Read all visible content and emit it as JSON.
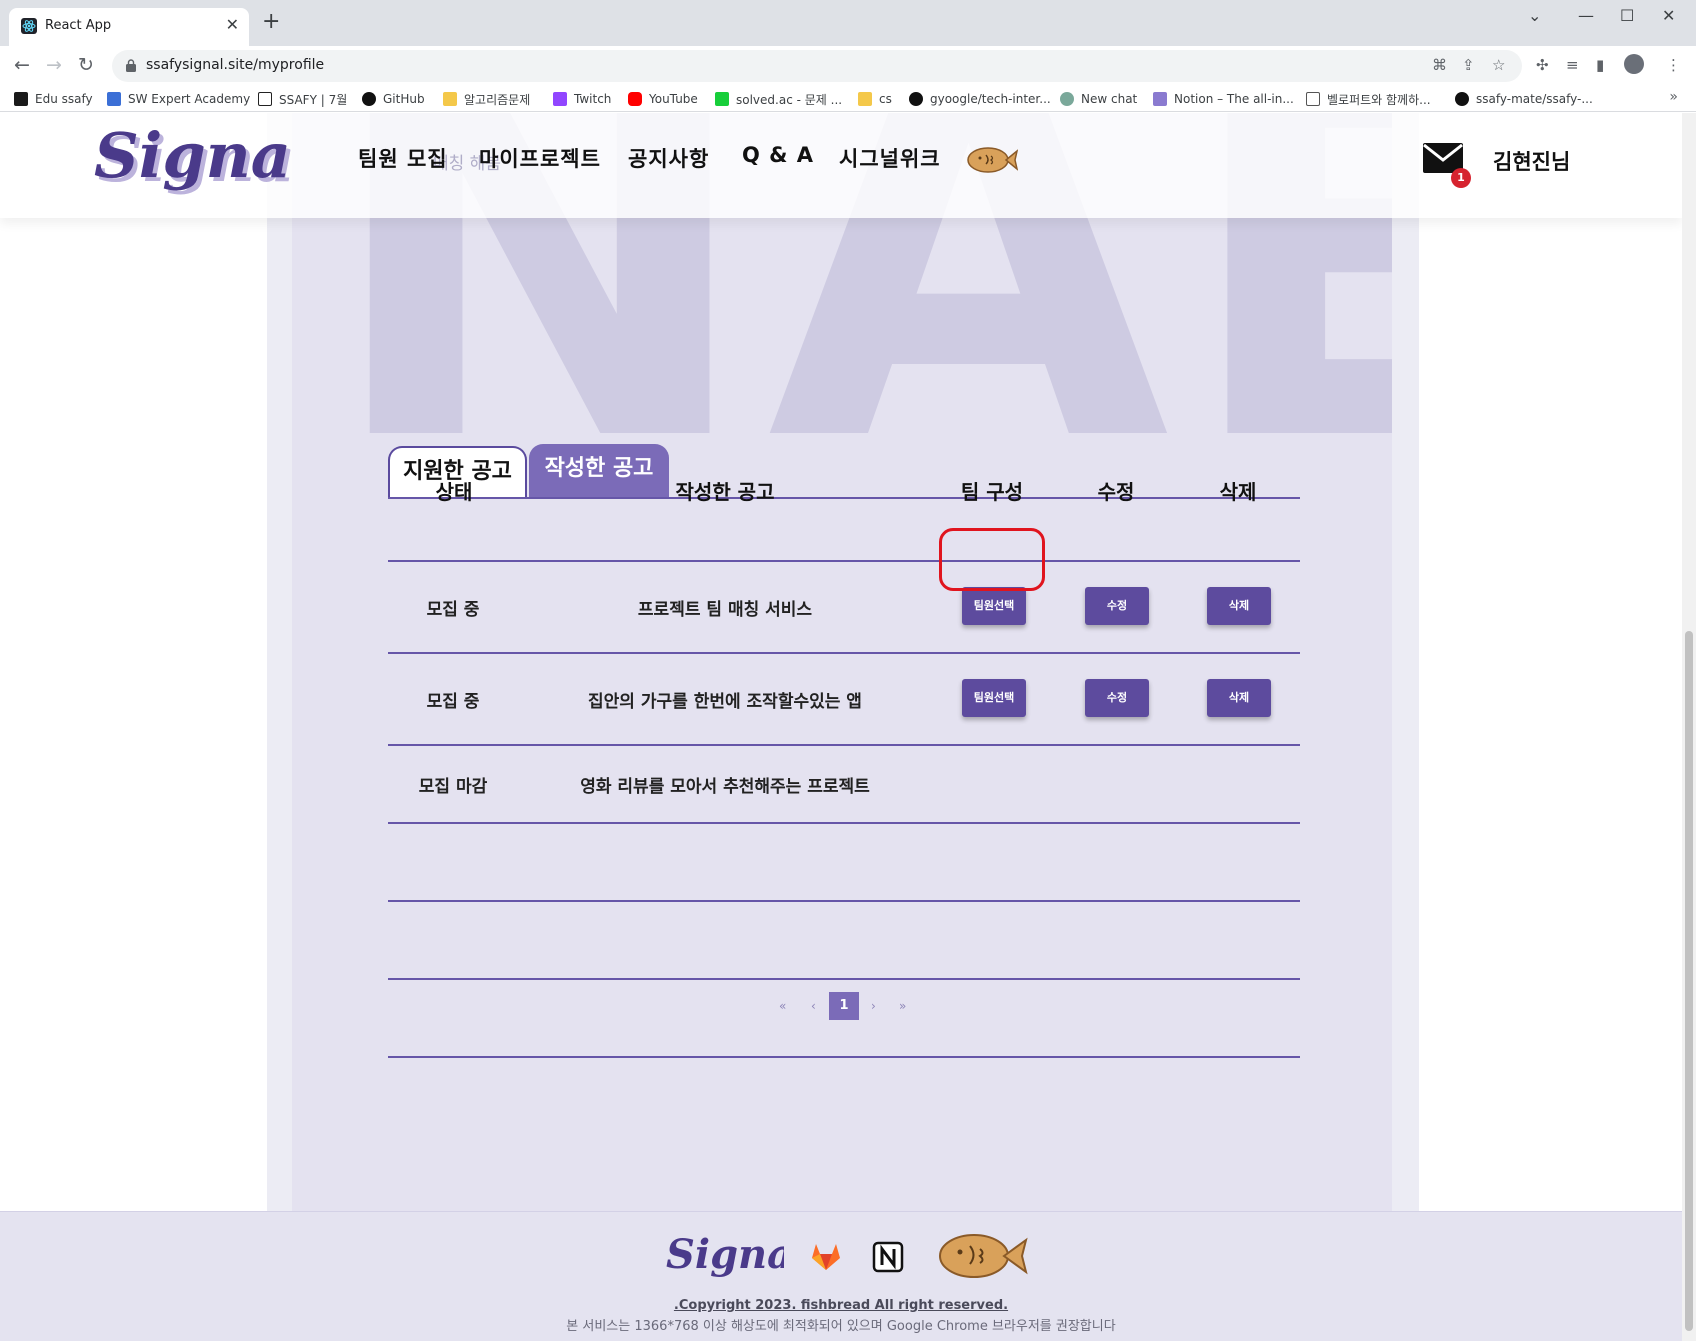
{
  "browser": {
    "tab_title": "React App",
    "url": "ssafysignal.site/myprofile",
    "bookmarks": [
      {
        "label": "Edu ssafy",
        "icon": "edu-ssafy-icon",
        "color": "#1a1a1a"
      },
      {
        "label": "SW Expert Academy",
        "icon": "swea-icon",
        "color": "#3b6fd6"
      },
      {
        "label": "SSAFY | 7월",
        "icon": "notion-icon",
        "color": "#222222"
      },
      {
        "label": "GitHub",
        "icon": "github-icon",
        "color": "#111111"
      },
      {
        "label": "알고리즘문제",
        "icon": "folder-icon",
        "color": "#f4c84a"
      },
      {
        "label": "Twitch",
        "icon": "twitch-icon",
        "color": "#9146ff"
      },
      {
        "label": "YouTube",
        "icon": "youtube-icon",
        "color": "#ff0000"
      },
      {
        "label": "solved.ac - 문제 ...",
        "icon": "solvedac-icon",
        "color": "#17ce3a"
      },
      {
        "label": "cs",
        "icon": "folder-icon",
        "color": "#f4c84a"
      },
      {
        "label": "gyoogle/tech-inter...",
        "icon": "github-icon",
        "color": "#111111"
      },
      {
        "label": "New chat",
        "icon": "chatgpt-icon",
        "color": "#7aa89a"
      },
      {
        "label": "Notion – The all-in...",
        "icon": "notion-bird-icon",
        "color": "#8a7ad0"
      },
      {
        "label": "벨로퍼트와 함께하...",
        "icon": "book-icon",
        "color": "#555555"
      },
      {
        "label": "ssafy-mate/ssafy-...",
        "icon": "github-icon",
        "color": "#111111"
      }
    ]
  },
  "header": {
    "logo_text": "Signal",
    "ghost_text": "매칭 해봄",
    "nav": [
      "팀원 모집",
      "마이프로젝트",
      "공지사항",
      "Q & A",
      "시그널위크"
    ],
    "mail_count": "1",
    "user_name": "김현진님"
  },
  "background_letters": "NAE",
  "tabs": [
    "지원한 공고",
    "작성한 공고"
  ],
  "table": {
    "headers": [
      "상태",
      "작성한 공고",
      "팀 구성",
      "수정",
      "삭제"
    ],
    "rows": [
      {
        "status": "모집 중",
        "title": "프로젝트 팀 매칭 서비스",
        "team_btn": "팀원선택",
        "edit_btn": "수정",
        "delete_btn": "삭제"
      },
      {
        "status": "모집 중",
        "title": "집안의 가구를 한번에 조작할수있는 앱",
        "team_btn": "팀원선택",
        "edit_btn": "수정",
        "delete_btn": "삭제"
      },
      {
        "status": "모집 마감",
        "title": "영화 리뷰를 모아서 추천해주는 프로젝트"
      }
    ]
  },
  "pagination": {
    "first": "«",
    "prev": "‹",
    "current": "1",
    "next": "›",
    "last": "»"
  },
  "footer": {
    "logo_text": "Signal",
    "copyright": ".Copyright 2023. fishbread All right reserved.",
    "notice": "본 서비스는 1366*768 이상 해상도에 최적화되어 있으며 Google Chrome 브라우저를 권장합니다"
  },
  "colors": {
    "accent": "#5d4b9e",
    "tab_active": "#7b6bb8",
    "highlight": "#e0141e",
    "panel": "#e4e2f0"
  }
}
